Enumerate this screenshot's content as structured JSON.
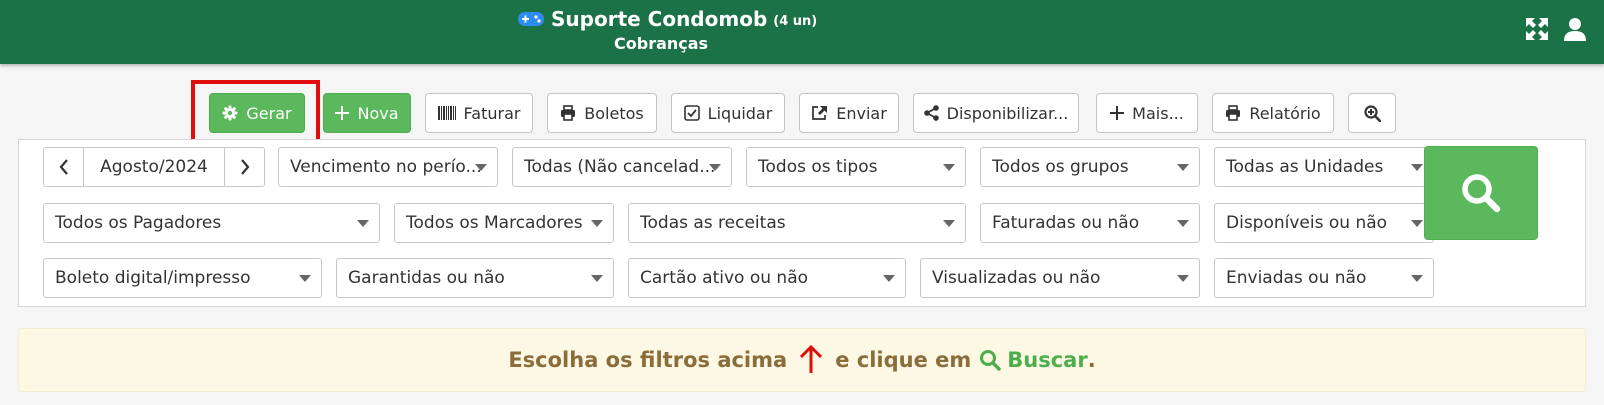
{
  "header": {
    "title": "Suporte Condomob",
    "units": "(4 un)",
    "subtitle": "Cobranças",
    "icons": [
      "gamepad-icon",
      "fullscreen-icon",
      "user-icon"
    ]
  },
  "toolbar": {
    "buttons": [
      {
        "label": "Gerar",
        "icon": "gear-icon"
      },
      {
        "label": "Nova",
        "icon": "plus-icon"
      },
      {
        "label": "Faturar",
        "icon": "barcode-icon"
      },
      {
        "label": "Boletos",
        "icon": "printer-icon"
      },
      {
        "label": "Liquidar",
        "icon": "checkbox-icon"
      },
      {
        "label": "Enviar",
        "icon": "share-icon"
      },
      {
        "label": "Disponibilizar...",
        "icon": "share-nodes-icon"
      },
      {
        "label": "Mais...",
        "icon": "plus-icon"
      },
      {
        "label": "Relatório",
        "icon": "printer-icon"
      },
      {
        "label": "",
        "icon": "zoom-in-icon"
      }
    ]
  },
  "filters": {
    "period": "Agosto/2024",
    "row1": [
      "Vencimento no perío...",
      "Todas (Não cancelad...",
      "Todos os tipos",
      "Todos os grupos",
      "Todas as Unidades"
    ],
    "row2": [
      "Todos os Pagadores",
      "Todos os Marcadores",
      "Todas as receitas",
      "Faturadas ou não",
      "Disponíveis ou não"
    ],
    "row3": [
      "Boleto digital/impresso",
      "Garantidas ou não",
      "Cartão ativo ou não",
      "Visualizadas ou não",
      "Enviadas ou não"
    ]
  },
  "info": {
    "text1": "Escolha os filtros acima",
    "text2": "e clique em",
    "link": "Buscar",
    "period": "."
  },
  "colors": {
    "header": "#1b7246",
    "primary_green": "#5cb85c",
    "highlight": "#e10e0e",
    "info_bg": "#fcf8e3",
    "info_text": "#8a6d3b",
    "arrow": "#e10e0e"
  }
}
